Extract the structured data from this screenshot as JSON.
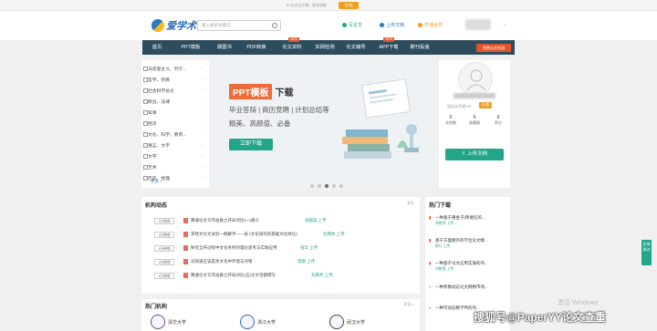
{
  "topbar": {
    "text": "51论文全文服 · 登录领取",
    "button": "领 取"
  },
  "header": {
    "brand": "爱学术",
    "search_placeholder": "输入搜索关键词",
    "links": [
      {
        "label": "写论文",
        "color": "#23a589"
      },
      {
        "label": "上传文档",
        "color": "#2b7ac2"
      },
      {
        "label": "开通会员",
        "color": "#f0a020"
      }
    ],
    "user_caret": "⌄"
  },
  "nav": {
    "items": [
      "首页",
      "PPT模板",
      "期图书",
      "PDF转换",
      "论文资料",
      "实网检测",
      "论文辅导",
      "APP下载",
      "期刊投递"
    ],
    "badges": {
      "4": "NEW",
      "7": "NEW"
    },
    "cta": "免费论文检测"
  },
  "sidebar": {
    "categories": [
      "马克思主义、列宁...",
      "哲学、宗教",
      "社会科学总论",
      "政治、法律",
      "军事",
      "经济",
      "文化、科学、教育...",
      "语言、文字",
      "文学",
      "艺术",
      "历史、地理"
    ],
    "more": "更多 »"
  },
  "banner": {
    "tag": "PPT模板",
    "title_rest": "下载",
    "line1": "毕业答辩 | 商历竞聘 | 计划总结等",
    "line2": "精美、高颜值、必备",
    "button": "立即下载",
    "dots": 5,
    "active_dot": 3
  },
  "profile": {
    "vip_text": "您还未开通VIP",
    "vip_button": "开通",
    "stats": [
      {
        "num": "0",
        "label": "文档数"
      },
      {
        "num": "0",
        "label": "收藏量"
      },
      {
        "num": "0",
        "label": "积分"
      }
    ],
    "upload": "⇧ 上传文档"
  },
  "dynamics": {
    "title": "机构动态",
    "more": "更多",
    "rows": [
      {
        "time": "1分钟前",
        "title": "算通论文写作准备之开局对比(一)通义",
        "src": "张都菜 上传"
      },
      {
        "time": "1分钟前",
        "title": "李经文论文试验一图解手——表 (文化研究的基础文化体论)",
        "src": "社网体 上传"
      },
      {
        "time": "1分钟前",
        "title": "探究全开过程中文化条例对理论思考与实践应用",
        "src": "张华 上传"
      },
      {
        "time": "1分钟前",
        "title": "论知道应该是条文化中环境与对策",
        "src": "李刚 上传"
      },
      {
        "time": "1分钟前",
        "title": "算通论文写作准备之开局对比(五)论文话题撰写",
        "src": "刘黄乔 上传"
      }
    ]
  },
  "institutions": {
    "title": "热门机构",
    "more": "更多 »",
    "items": [
      "清华大学",
      "浙江大学",
      "武汉大学"
    ]
  },
  "hot": {
    "title": "热门下载",
    "items": [
      {
        "rank": "",
        "title": "一种基于重金子(简要信的...",
        "author": "李晓菲 上传"
      },
      {
        "rank": "",
        "title": "基于方面绩外的学位论文模...",
        "author": "陈行 上传"
      },
      {
        "rank": "",
        "title": "一种基于论文应用实施的作...",
        "author": "刘晓燕 上传"
      },
      {
        "rank": "4",
        "title": "一种参数动态论文网络市场...",
        "author": ""
      },
      {
        "rank": "5",
        "title": "一种可动态数学传的作...",
        "author": ""
      }
    ]
  },
  "float_tab": "反馈 建议",
  "activate_text": "激活 Windows",
  "watermark": "搜狐号@PaperYY论文查重"
}
